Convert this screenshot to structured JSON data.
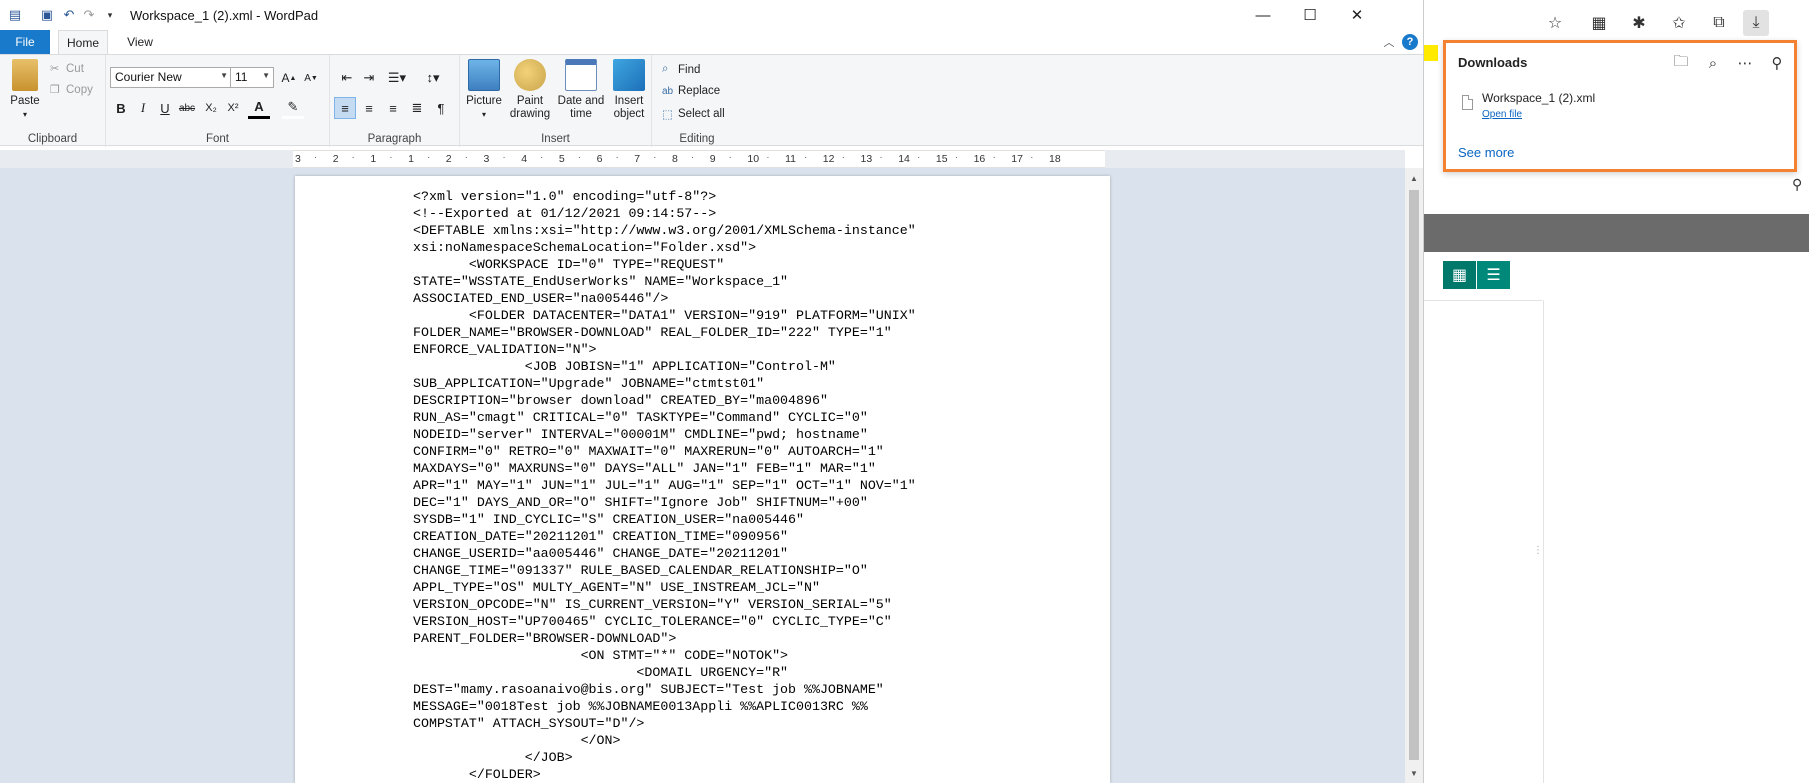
{
  "wordpad": {
    "title": "Workspace_1 (2).xml - WordPad",
    "tabs": {
      "file": "File",
      "home": "Home",
      "view": "View"
    },
    "clipboard": {
      "paste": "Paste",
      "cut": "Cut",
      "copy": "Copy",
      "label": "Clipboard"
    },
    "font": {
      "family": "Courier New",
      "size": "11",
      "label": "Font",
      "bold": "B",
      "italic": "I",
      "underline": "U",
      "strike": "abc",
      "sub": "X₂",
      "sup": "X²",
      "color": "A"
    },
    "paragraph": {
      "label": "Paragraph"
    },
    "insert": {
      "picture": "Picture",
      "paint_drawing": "Paint drawing",
      "date_time": "Date and time",
      "insert_object": "Insert object",
      "label": "Insert"
    },
    "editing": {
      "find": "Find",
      "replace": "Replace",
      "select_all": "Select all",
      "label": "Editing"
    },
    "ruler": [
      "3",
      "2",
      "1",
      "1",
      "2",
      "3",
      "4",
      "5",
      "6",
      "7",
      "8",
      "9",
      "10",
      "11",
      "12",
      "13",
      "14",
      "15",
      "16",
      "17",
      "18"
    ],
    "document_lines": [
      "<?xml version=\"1.0\" encoding=\"utf-8\"?>",
      "<!--Exported at 01/12/2021 09:14:57-->",
      "<DEFTABLE xmlns:xsi=\"http://www.w3.org/2001/XMLSchema-instance\"",
      "xsi:noNamespaceSchemaLocation=\"Folder.xsd\">",
      "       <WORKSPACE ID=\"0\" TYPE=\"REQUEST\"",
      "STATE=\"WSSTATE_EndUserWorks\" NAME=\"Workspace_1\"",
      "ASSOCIATED_END_USER=\"na005446\"/>",
      "       <FOLDER DATACENTER=\"DATA1\" VERSION=\"919\" PLATFORM=\"UNIX\"",
      "FOLDER_NAME=\"BROWSER-DOWNLOAD\" REAL_FOLDER_ID=\"222\" TYPE=\"1\"",
      "ENFORCE_VALIDATION=\"N\">",
      "              <JOB JOBISN=\"1\" APPLICATION=\"Control-M\"",
      "SUB_APPLICATION=\"Upgrade\" JOBNAME=\"ctmtst01\"",
      "DESCRIPTION=\"browser download\" CREATED_BY=\"ma004896\"",
      "RUN_AS=\"cmagt\" CRITICAL=\"0\" TASKTYPE=\"Command\" CYCLIC=\"0\"",
      "NODEID=\"server\" INTERVAL=\"00001M\" CMDLINE=\"pwd; hostname\"",
      "CONFIRM=\"0\" RETRO=\"0\" MAXWAIT=\"0\" MAXRERUN=\"0\" AUTOARCH=\"1\"",
      "MAXDAYS=\"0\" MAXRUNS=\"0\" DAYS=\"ALL\" JAN=\"1\" FEB=\"1\" MAR=\"1\"",
      "APR=\"1\" MAY=\"1\" JUN=\"1\" JUL=\"1\" AUG=\"1\" SEP=\"1\" OCT=\"1\" NOV=\"1\"",
      "DEC=\"1\" DAYS_AND_OR=\"O\" SHIFT=\"Ignore Job\" SHIFTNUM=\"+00\"",
      "SYSDB=\"1\" IND_CYCLIC=\"S\" CREATION_USER=\"na005446\"",
      "CREATION_DATE=\"20211201\" CREATION_TIME=\"090956\"",
      "CHANGE_USERID=\"aa005446\" CHANGE_DATE=\"20211201\"",
      "CHANGE_TIME=\"091337\" RULE_BASED_CALENDAR_RELATIONSHIP=\"O\"",
      "APPL_TYPE=\"OS\" MULTY_AGENT=\"N\" USE_INSTREAM_JCL=\"N\"",
      "VERSION_OPCODE=\"N\" IS_CURRENT_VERSION=\"Y\" VERSION_SERIAL=\"5\"",
      "VERSION_HOST=\"UP700465\" CYCLIC_TOLERANCE=\"0\" CYCLIC_TYPE=\"C\"",
      "PARENT_FOLDER=\"BROWSER-DOWNLOAD\">",
      "                     <ON STMT=\"*\" CODE=\"NOTOK\">",
      "                            <DOMAIL URGENCY=\"R\"",
      "DEST=\"mamy.rasoanaivo@bis.org\" SUBJECT=\"Test job %%JOBNAME\"",
      "MESSAGE=\"0018Test job %%JOBNAME0013Appli %%APLIC0013RC %%",
      "COMPSTAT\" ATTACH_SYSOUT=\"D\"/>",
      "                     </ON>",
      "              </JOB>",
      "       </FOLDER>"
    ]
  },
  "downloads": {
    "title": "Downloads",
    "file_name": "Workspace_1 (2).xml",
    "open_file": "Open file",
    "see_more": "See more"
  },
  "colors": {
    "accent": "#1979ca",
    "highlight": "#f58233",
    "teal": "#00897b"
  }
}
